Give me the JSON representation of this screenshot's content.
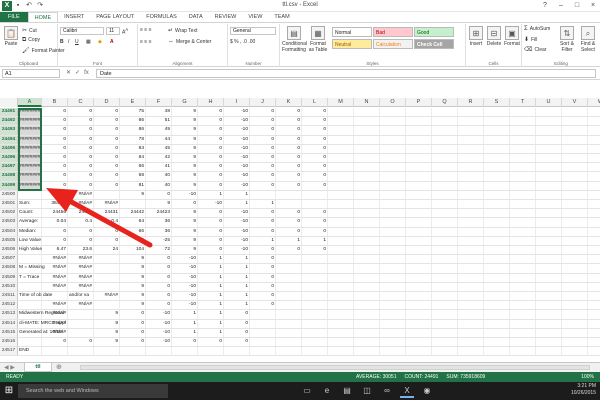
{
  "window": {
    "title": "ttl.csv - Excel"
  },
  "tabs": [
    "FILE",
    "HOME",
    "INSERT",
    "PAGE LAYOUT",
    "FORMULAS",
    "DATA",
    "REVIEW",
    "VIEW",
    "TEAM"
  ],
  "ribbon": {
    "clipboard": {
      "paste": "Paste",
      "cut": "Cut",
      "copy": "Copy",
      "format_painter": "Format Painter",
      "label": "Clipboard"
    },
    "font": {
      "name": "Calibri",
      "size": "11",
      "label": "Font"
    },
    "alignment": {
      "wrap": "Wrap Text",
      "merge": "Merge & Center",
      "label": "Alignment"
    },
    "number": {
      "format": "General",
      "label": "Number"
    },
    "styles": {
      "conditional": "Conditional Formatting",
      "format_table": "Format as Table",
      "normal": "Normal",
      "bad": "Bad",
      "good": "Good",
      "neutral": "Neutral",
      "calculation": "Calculation",
      "check_cell": "Check Cell",
      "label": "Styles"
    },
    "cells": {
      "insert": "Insert",
      "delete": "Delete",
      "format": "Format",
      "label": "Cells"
    },
    "editing": {
      "autosum": "AutoSum",
      "fill": "Fill",
      "clear": "Clear",
      "sort": "Sort & Filter",
      "find": "Find & Select",
      "label": "Editing"
    }
  },
  "formula_bar": {
    "name_box": "A1",
    "content": "Date"
  },
  "columns": [
    "A",
    "B",
    "C",
    "D",
    "E",
    "F",
    "G",
    "H",
    "I",
    "J",
    "K",
    "L",
    "M",
    "N",
    "O",
    "P",
    "Q",
    "R",
    "S",
    "T",
    "U",
    "V",
    "W"
  ],
  "rows": [
    {
      "n": "24491",
      "cells": [
        "########",
        "0",
        "0",
        "0",
        "75",
        "48",
        "9",
        "0",
        "-10",
        "0",
        "0",
        "0"
      ]
    },
    {
      "n": "24492",
      "cells": [
        "########",
        "0",
        "0",
        "0",
        "86",
        "51",
        "9",
        "0",
        "-10",
        "0",
        "0",
        "0"
      ]
    },
    {
      "n": "24493",
      "cells": [
        "########",
        "0",
        "0",
        "0",
        "86",
        "49",
        "9",
        "0",
        "-10",
        "0",
        "0",
        "0"
      ]
    },
    {
      "n": "24494",
      "cells": [
        "########",
        "0",
        "0",
        "0",
        "78",
        "44",
        "9",
        "0",
        "-10",
        "0",
        "0",
        "0"
      ]
    },
    {
      "n": "24495",
      "cells": [
        "########",
        "0",
        "0",
        "0",
        "83",
        "45",
        "9",
        "0",
        "-10",
        "0",
        "0",
        "0"
      ]
    },
    {
      "n": "24496",
      "cells": [
        "########",
        "0",
        "0",
        "0",
        "84",
        "42",
        "9",
        "0",
        "-10",
        "0",
        "0",
        "0"
      ]
    },
    {
      "n": "24497",
      "cells": [
        "########",
        "0",
        "0",
        "0",
        "66",
        "41",
        "9",
        "0",
        "-10",
        "0",
        "0",
        "0"
      ]
    },
    {
      "n": "24498",
      "cells": [
        "########",
        "0",
        "0",
        "0",
        "68",
        "40",
        "9",
        "0",
        "-10",
        "0",
        "0",
        "0"
      ]
    },
    {
      "n": "24499",
      "cells": [
        "########",
        "0",
        "0",
        "0",
        "81",
        "40",
        "9",
        "0",
        "-10",
        "0",
        "0",
        "0"
      ]
    },
    {
      "n": "24500",
      "cells": [
        "",
        "",
        "#N/A#",
        "",
        "9",
        "0",
        "-10",
        "1",
        "1",
        "",
        "",
        ""
      ]
    },
    {
      "n": "24501",
      "cells": [
        "Sum:",
        "3845.6",
        "#N/A#",
        "#N/A#",
        "",
        "9",
        "0",
        "-10",
        "1",
        "1",
        "",
        ""
      ]
    },
    {
      "n": "24502",
      "cells": [
        "Count:",
        "24456",
        "24456",
        "24431",
        "24442",
        "24423",
        "9",
        "0",
        "-10",
        "0",
        "0",
        "0"
      ]
    },
    {
      "n": "24503",
      "cells": [
        "Average:",
        "0.04",
        "0.4",
        "0.4",
        "64",
        "36",
        "9",
        "0",
        "-10",
        "0",
        "0",
        "0"
      ]
    },
    {
      "n": "24504",
      "cells": [
        "Median:",
        "0",
        "0",
        "0",
        "66",
        "36",
        "9",
        "0",
        "-10",
        "0",
        "0",
        "0"
      ]
    },
    {
      "n": "24505",
      "cells": [
        "Low Value",
        "0",
        "0",
        "0",
        "-9",
        "-25",
        "9",
        "0",
        "-10",
        "1",
        "1",
        "1"
      ]
    },
    {
      "n": "24506",
      "cells": [
        "High Value",
        "6.47",
        "23.6",
        "24",
        "104",
        "72",
        "9",
        "0",
        "-10",
        "0",
        "0",
        "0"
      ]
    },
    {
      "n": "24507",
      "cells": [
        "",
        "#N/A#",
        "#N/A#",
        "",
        "9",
        "0",
        "-10",
        "1",
        "1",
        "0",
        "",
        ""
      ]
    },
    {
      "n": "24508",
      "cells": [
        "M = Missing",
        "#N/A#",
        "#N/A#",
        "",
        "9",
        "0",
        "-10",
        "1",
        "1",
        "0",
        "",
        ""
      ]
    },
    {
      "n": "24509",
      "cells": [
        "T = Trace",
        "#N/A#",
        "#N/A#",
        "",
        "9",
        "0",
        "-10",
        "1",
        "1",
        "0",
        "",
        ""
      ]
    },
    {
      "n": "24510",
      "cells": [
        "",
        "#N/A#",
        "#N/A#",
        "",
        "9",
        "0",
        "-10",
        "1",
        "1",
        "0",
        "",
        ""
      ]
    },
    {
      "n": "24511",
      "cells": [
        "Time of ob",
        "date",
        "and/or va",
        "#N/A#",
        "9",
        "0",
        "-10",
        "1",
        "1",
        "0",
        "",
        ""
      ]
    },
    {
      "n": "24512",
      "cells": [
        "",
        "#N/A#",
        "#N/A#",
        "",
        "9",
        "0",
        "-10",
        "1",
        "1",
        "0",
        "",
        ""
      ]
    },
    {
      "n": "24513",
      "cells": [
        "Midwestern Regional",
        "#N/A#",
        "",
        "9",
        "0",
        "-10",
        "1",
        "1",
        "0",
        "",
        "",
        ""
      ]
    },
    {
      "n": "24514",
      "cells": [
        "cli-MATE: MRCC Appl",
        "#N/A#",
        "",
        "9",
        "0",
        "-10",
        "1",
        "1",
        "0",
        "",
        "",
        ""
      ]
    },
    {
      "n": "24515",
      "cells": [
        "Generated at: 10/19/",
        "#N/A#",
        "",
        "9",
        "0",
        "-10",
        "1",
        "1",
        "0",
        "",
        "",
        ""
      ]
    },
    {
      "n": "24516",
      "cells": [
        "",
        "0",
        "0",
        "9",
        "0",
        "-10",
        "0",
        "0",
        "0",
        "",
        "",
        ""
      ]
    },
    {
      "n": "24517",
      "cells": [
        "END",
        "",
        "",
        "",
        "",
        "",
        "",
        "",
        "",
        "",
        "",
        ""
      ]
    }
  ],
  "sheet_tab": "ttl",
  "status": {
    "ready": "READY",
    "average": "AVERAGE: 30051",
    "count": "COUNT: 24491",
    "sum": "SUM: 735918609",
    "zoom": "100%"
  },
  "taskbar": {
    "search": "Search the web and Windows",
    "time": "3:21 PM",
    "date": "10/26/2015"
  }
}
